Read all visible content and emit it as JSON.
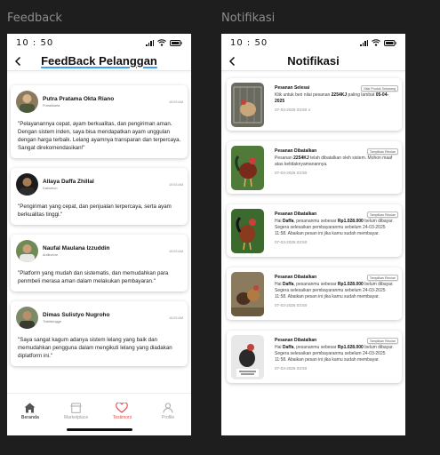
{
  "frames": {
    "left_label": "Feedback",
    "right_label": "Notifikasi"
  },
  "status": {
    "time": "10 : 50"
  },
  "feedback": {
    "title": "FeedBack Pelanggan",
    "cards": [
      {
        "name": "Putra Pratama Okta Riano",
        "handle": "Putrakkarta",
        "time": "10:03 AM",
        "text": "\"Pelayanannya cepat, ayam berkualitas, dan pengiriman aman. Dengan sistem inden, saya bisa mendapatkan ayam unggulan dengan harga terbaik. Lelang ayamnya transparan dan terpercaya. Sangat direkomendasikan!\""
      },
      {
        "name": "Allaya Daffa Zhillal",
        "handle": "Daburkun",
        "time": "10:03 AM",
        "text": "\"Pengiriman yang cepat, dan penjualan terpercaya, serta ayam berkualitas tinggi.\""
      },
      {
        "name": "Naufal Maulana Izzuddin",
        "handle": "Antikurcre",
        "time": "10:03 AM",
        "text": "\"Platform yang mudah dan sistematis, dan memudahkan para penmbeli merasa aman dalam melakukan pembayaran.\""
      },
      {
        "name": "Dimas Sulistyo Nugroho",
        "handle": "Trabisbugge",
        "time": "10:03 AM",
        "text": "\"Saya sangat kagum adanya sistem lelang yang baik dan memudahkan pengguna dalam mengikuti lelang yang diadakan diplatform ini.\""
      }
    ]
  },
  "nav": {
    "items": [
      {
        "label": "Beranda"
      },
      {
        "label": "Marketplace"
      },
      {
        "label": "Testimoni"
      },
      {
        "label": "Profile"
      }
    ]
  },
  "notifications": {
    "title": "Notifikasi",
    "cards": [
      {
        "title": "Pesanan Selesai",
        "chip": "Nilai Produk Sekarang",
        "text_parts": [
          "Klik untuk beri nilai pesanan ",
          "2254KJ",
          " paling lambat ",
          "05-04-2025",
          ""
        ],
        "time": "07-03-2025 03:50 ∨"
      },
      {
        "title": "Pesanan Dibatalkan",
        "chip": "Tampilkan Rincian",
        "text_parts": [
          "Pesanan ",
          "2254KJ",
          " telah dibatalkan oleh sistem. Mohon maaf atas ketidaknyamanannya.",
          "",
          ""
        ],
        "time": "07-03-2025 03:50"
      },
      {
        "title": "Pesanan Dibatalkan",
        "chip": "Tampilkan Rincian",
        "text_parts": [
          "Hai ",
          "Daffa",
          ", pesananmu sebesar ",
          "Rp1.028.000",
          " belum dibayar. Segera selesaikan pembayaranmu sebelum 24-03-2025 11:58. Abaikan pesan ini jika kamu sudah membayar."
        ],
        "time": "07-03-2025 03:50"
      },
      {
        "title": "Pesanan Dibatalkan",
        "chip": "Tampilkan Rincian",
        "text_parts": [
          "Hai ",
          "Daffa",
          ", pesananmu sebesar ",
          "Rp1.028.000",
          " belum dibayar. Segera selesaikan pembayaranmu sebelum 24-03-2025 11:58. Abaikan pesan ini jika kamu sudah membayar."
        ],
        "time": "07-03-2025 03:50"
      },
      {
        "title": "Pesanan Dibatalkan",
        "chip": "Tampilkan Rincian",
        "text_parts": [
          "Hai ",
          "Daffa",
          ", pesananmu sebesar ",
          "Rp1.028.000",
          " belum dibayar. Segera selesaikan pembayaranmu sebelum 24-03-2025 11:58. Abaikan pesan ini jika kamu sudah membayar."
        ],
        "time": "07-03-2025 03:50"
      }
    ]
  },
  "colors": {
    "accent_blue": "#3ca0ff",
    "active_red": "#e84b4b",
    "canvas": "#1e1e1e"
  }
}
